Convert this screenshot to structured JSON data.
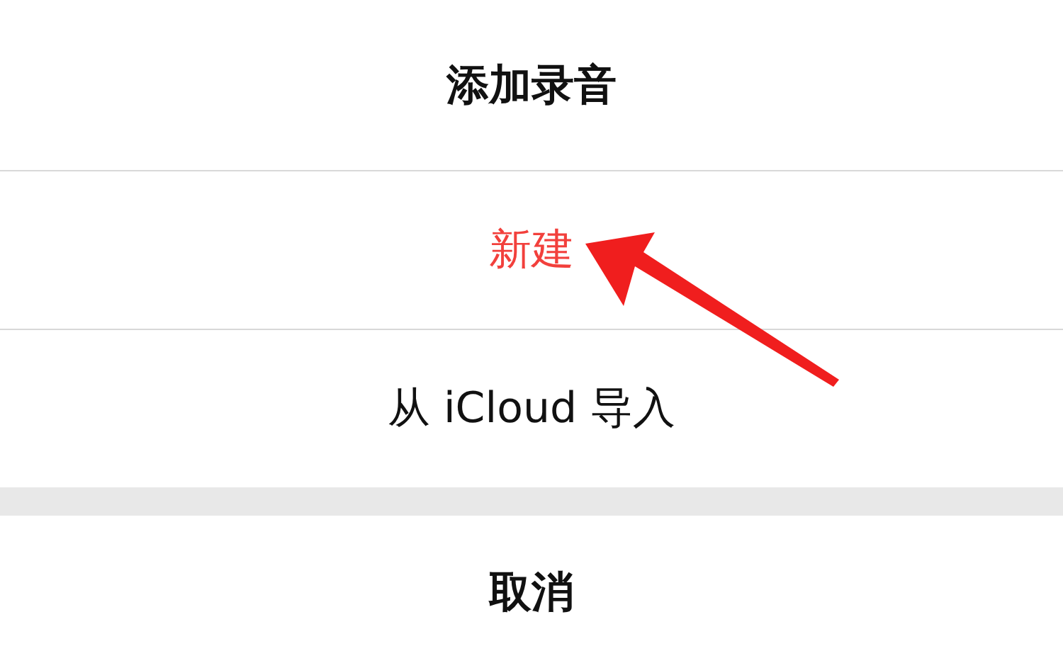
{
  "action_sheet": {
    "title": "添加录音",
    "actions": [
      {
        "label": "新建",
        "kind": "destructive"
      },
      {
        "label": "从 iCloud 导入",
        "kind": "default"
      }
    ]
  },
  "cancel_button": {
    "label": "取消"
  }
}
